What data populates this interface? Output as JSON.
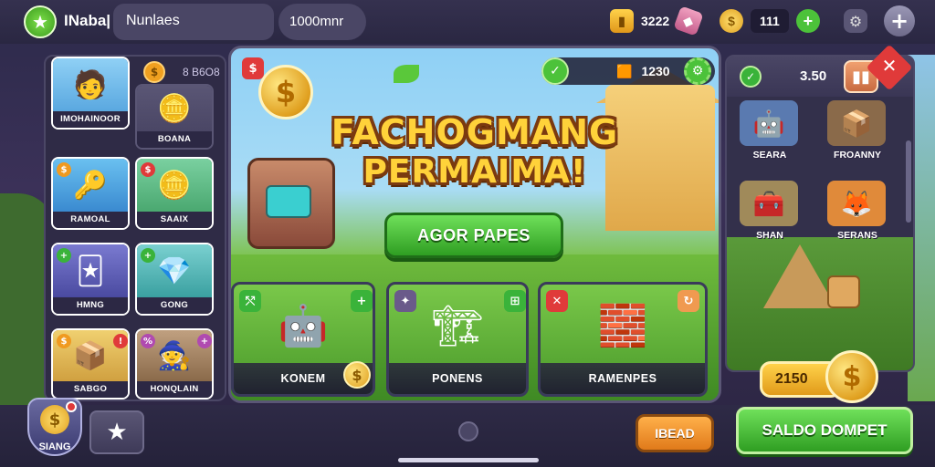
{
  "topbar": {
    "title": "INaba|",
    "pill_1": "Nunlaes",
    "pill_2": "1000mnr",
    "gems": "3222",
    "coins": "111"
  },
  "left_panel": {
    "top_value": "8 B6O8",
    "cards": [
      {
        "label": "IMOHAINOOR"
      },
      {
        "label": "BOANA"
      },
      {
        "label": "RAMOAL"
      },
      {
        "label": "SAAIX"
      },
      {
        "label": "HMNG"
      },
      {
        "label": "GONG"
      },
      {
        "label": "SABGO"
      },
      {
        "label": "HONQLAIN"
      }
    ]
  },
  "main_panel": {
    "title_line_1": "FACHOGMANG",
    "title_line_2": "PERMAIMA!",
    "resource_value": "1230",
    "play_button": "AGOR PAPES",
    "cards": [
      {
        "label": "KONEM"
      },
      {
        "label": "PONENS"
      },
      {
        "label": "RAMENPES"
      }
    ]
  },
  "right_panel": {
    "value": "3.50",
    "items": [
      {
        "label": "SEARA"
      },
      {
        "label": "FROANNY"
      },
      {
        "label": "SHAN"
      },
      {
        "label": "SERANS"
      }
    ],
    "coin_value": "2150"
  },
  "bottombar": {
    "shield_label": "SIANG",
    "orange_button": "IBEAD",
    "green_button": "SALDO DOMPET"
  }
}
